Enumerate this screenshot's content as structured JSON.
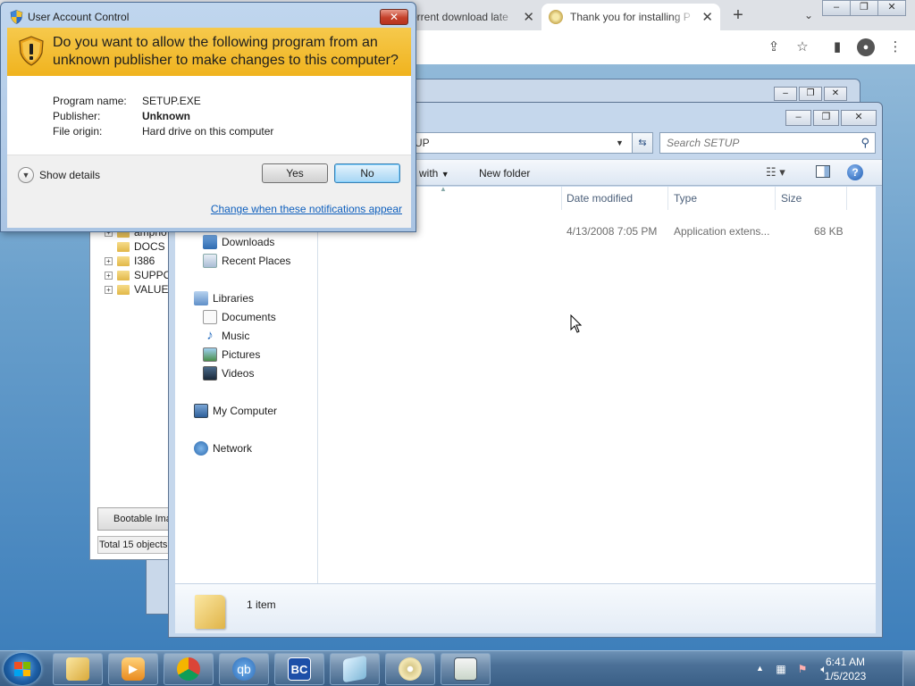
{
  "browser": {
    "tabs": [
      {
        "title": "orrent download late"
      },
      {
        "title": "Thank you for installing P"
      }
    ]
  },
  "uac": {
    "window_title": "User Account Control",
    "question": "Do you want to allow the following program from an unknown publisher to make changes to this computer?",
    "fields": [
      {
        "label": "Program name:",
        "value": "SETUP.EXE"
      },
      {
        "label": "Publisher:",
        "value": "Unknown"
      },
      {
        "label": "File origin:",
        "value": "Hard drive on this computer"
      }
    ],
    "show_details": "Show details",
    "yes_label": "Yes",
    "no_label": "No",
    "notifications_link": "Change when these notifications appear"
  },
  "old_explorer": {
    "tree_items": [
      "ampno",
      "DOCS",
      "I386",
      "SUPPO",
      "VALUE"
    ],
    "tab_label": "Bootable Ima",
    "status": "Total 15 objects"
  },
  "explorer": {
    "address": "UP",
    "search_placeholder": "Search SETUP",
    "cmd_open_with": "with",
    "cmd_new_folder": "New folder",
    "nav": {
      "downloads": "Downloads",
      "recent_places": "Recent Places",
      "libraries": "Libraries",
      "documents": "Documents",
      "music": "Music",
      "pictures": "Pictures",
      "videos": "Videos",
      "my_computer": "My Computer",
      "network": "Network"
    },
    "columns": {
      "date_modified": "Date modified",
      "type": "Type",
      "size": "Size"
    },
    "rows": [
      {
        "date_modified": "4/13/2008 7:05 PM",
        "type": "Application extens...",
        "size": "68 KB"
      }
    ],
    "item_count": "1 item"
  },
  "taskbar": {
    "apps": [
      {
        "name": "explorer",
        "label": ""
      },
      {
        "name": "media",
        "label": ""
      },
      {
        "name": "chrome",
        "label": ""
      },
      {
        "name": "qbittorrent",
        "label": "qb"
      },
      {
        "name": "bc",
        "label": "BC"
      },
      {
        "name": "notepad",
        "label": ""
      },
      {
        "name": "disc",
        "label": ""
      },
      {
        "name": "app",
        "label": ""
      }
    ],
    "time": "6:41 AM",
    "date": "1/5/2023"
  }
}
